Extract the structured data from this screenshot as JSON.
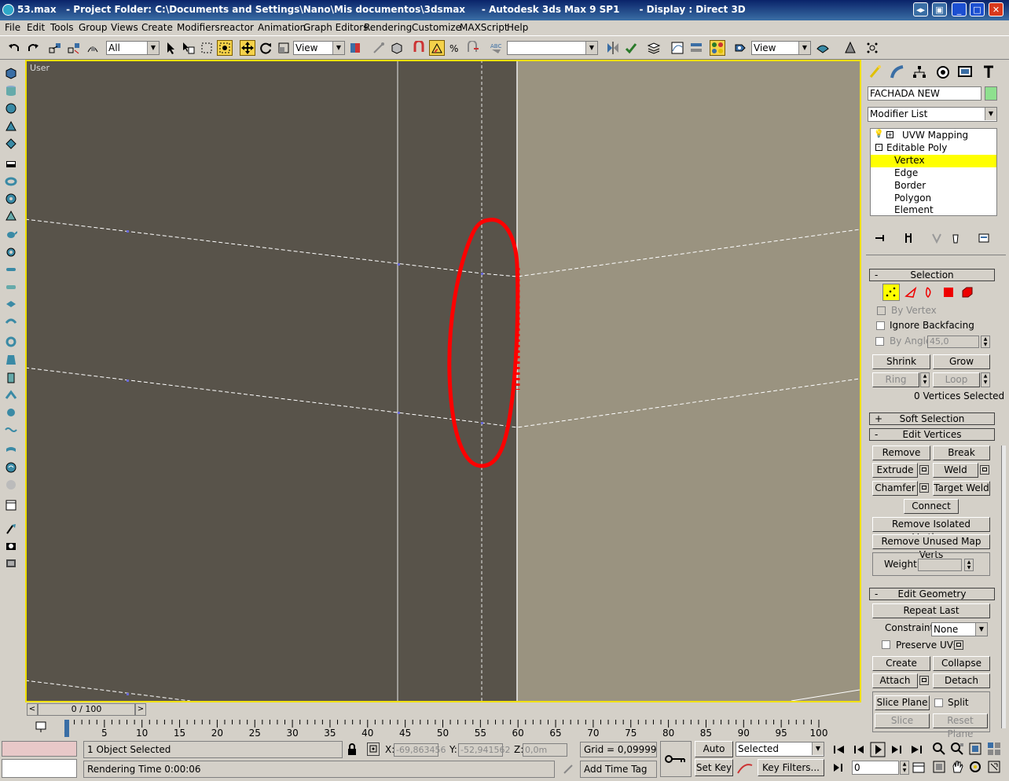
{
  "window": {
    "title": "53.max   - Project Folder: C:\\Documents and Settings\\Nano\\Mis documentos\\3dsmax     - Autodesk 3ds Max 9 SP1      - Display : Direct 3D"
  },
  "menu": [
    "File",
    "Edit",
    "Tools",
    "Group",
    "Views",
    "Create",
    "Modifiers",
    "reactor",
    "Animation",
    "Graph Editors",
    "Rendering",
    "Customize",
    "MAXScript",
    "Help"
  ],
  "toolbar": {
    "selection_filter": "All",
    "ref_coord": "View",
    "named_selection": "",
    "render_view": "View"
  },
  "viewport": {
    "label": "User"
  },
  "panel": {
    "object_name": "FACHADA NEW",
    "object_color": "#8ee08e",
    "modifier_list": "Modifier List",
    "stack": [
      "UVW Mapping",
      "Editable Poly",
      "Vertex",
      "Edge",
      "Border",
      "Polygon",
      "Element"
    ],
    "selection": {
      "title": "Selection",
      "by_vertex": "By Vertex",
      "ignore_backfacing": "Ignore Backfacing",
      "by_angle": "By Angle:",
      "angle_value": "45,0",
      "shrink": "Shrink",
      "grow": "Grow",
      "ring": "Ring",
      "loop": "Loop",
      "status": "0 Vertices Selected"
    },
    "soft_selection": "Soft Selection",
    "edit_vertices": {
      "title": "Edit Vertices",
      "remove": "Remove",
      "break": "Break",
      "extrude": "Extrude",
      "weld": "Weld",
      "chamfer": "Chamfer",
      "target_weld": "Target Weld",
      "connect": "Connect",
      "remove_isolated": "Remove Isolated Vertices",
      "remove_unused": "Remove Unused Map Verts",
      "weight": "Weight:"
    },
    "edit_geometry": {
      "title": "Edit Geometry",
      "repeat_last": "Repeat Last",
      "constraints": "Constraints:",
      "constraints_value": "None",
      "preserve_uvs": "Preserve UVs",
      "create": "Create",
      "collapse": "Collapse",
      "attach": "Attach",
      "detach": "Detach",
      "slice_plane": "Slice Plane",
      "split": "Split",
      "slice": "Slice",
      "reset_plane": "Reset Plane"
    }
  },
  "timeline": {
    "frame": "0 / 100",
    "ticks": [
      "0",
      "5",
      "10",
      "15",
      "20",
      "25",
      "30",
      "35",
      "40",
      "45",
      "50",
      "55",
      "60",
      "65",
      "70",
      "75",
      "80",
      "85",
      "90",
      "95",
      "100"
    ]
  },
  "status": {
    "selected": "1 Object Selected",
    "rendering_time": "Rendering Time  0:00:06",
    "x_label": "X:",
    "x_value": "-69,863456",
    "y_label": "Y:",
    "y_value": "-52,941562",
    "z_label": "Z:",
    "z_value": "0,0m",
    "grid": "Grid = 0,0999999999",
    "add_time_tag": "Add Time Tag",
    "auto_key": "Auto Key",
    "set_key": "Set Key",
    "key_mode": "Selected",
    "key_filters": "Key Filters...",
    "current_frame": "0"
  }
}
